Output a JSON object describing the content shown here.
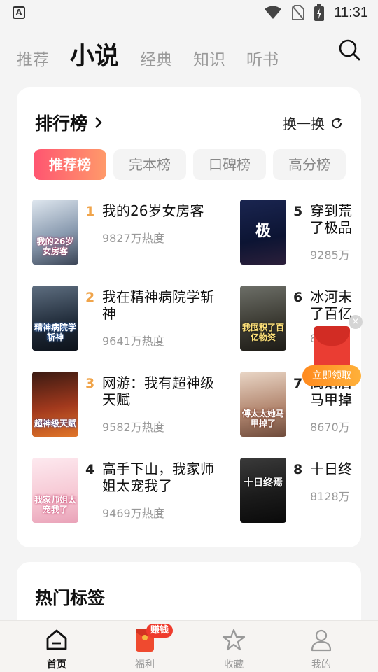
{
  "status_bar": {
    "left_icon": "A",
    "time": "11:31",
    "icons": [
      "wifi-icon",
      "no-sim-icon",
      "battery-charging-icon"
    ]
  },
  "top_tabs": [
    {
      "label": "推荐",
      "active": false
    },
    {
      "label": "小说",
      "active": true
    },
    {
      "label": "经典",
      "active": false
    },
    {
      "label": "知识",
      "active": false
    },
    {
      "label": "听书",
      "active": false
    }
  ],
  "ranking": {
    "title": "排行榜",
    "refresh_label": "换一换",
    "tabs": [
      {
        "label": "推荐榜",
        "active": true
      },
      {
        "label": "完本榜",
        "active": false
      },
      {
        "label": "口碑榜",
        "active": false
      },
      {
        "label": "高分榜",
        "active": false
      }
    ],
    "books": [
      {
        "rank": "1",
        "title": "我的26岁女房客",
        "heat": "9827万热度",
        "cover_text": "我的26岁女房客"
      },
      {
        "rank": "2",
        "title": "我在精神病院学斩神",
        "heat": "9641万热度",
        "cover_text": "精神病院学斩神"
      },
      {
        "rank": "3",
        "title": "网游：我有超神级天赋",
        "heat": "9582万热度",
        "cover_text": "超神级天赋"
      },
      {
        "rank": "4",
        "title": "高手下山，我家师姐太宠我了",
        "heat": "9469万热度",
        "cover_text": "我家师姐太宠我了"
      },
      {
        "rank": "5",
        "title": "穿到荒了极品",
        "heat": "9285万",
        "cover_text": "极"
      },
      {
        "rank": "6",
        "title": "冰河末了百亿",
        "heat": "8",
        "cover_text": "我囤积了百亿物资"
      },
      {
        "rank": "7",
        "title": "离婚后马甲掉",
        "heat": "8670万",
        "cover_text": "傅太太她马甲掉了"
      },
      {
        "rank": "8",
        "title": "十日终",
        "heat": "8128万",
        "cover_text": "十日终焉"
      }
    ]
  },
  "float_ad": {
    "button_label": "立即领取",
    "close": "×"
  },
  "hot_tags": {
    "title": "热门标签"
  },
  "bottom_nav": [
    {
      "label": "首页",
      "icon": "home-icon",
      "active": true
    },
    {
      "label": "福利",
      "icon": "red-packet-icon",
      "active": false,
      "badge": "赚钱"
    },
    {
      "label": "收藏",
      "icon": "star-icon",
      "active": false
    },
    {
      "label": "我的",
      "icon": "profile-icon",
      "active": false
    }
  ],
  "colors": {
    "accent_gradient_start": "#ff5571",
    "accent_gradient_end": "#ff9a6a",
    "rank_top": "#f0a44a",
    "badge_red": "#ef3b2d"
  }
}
